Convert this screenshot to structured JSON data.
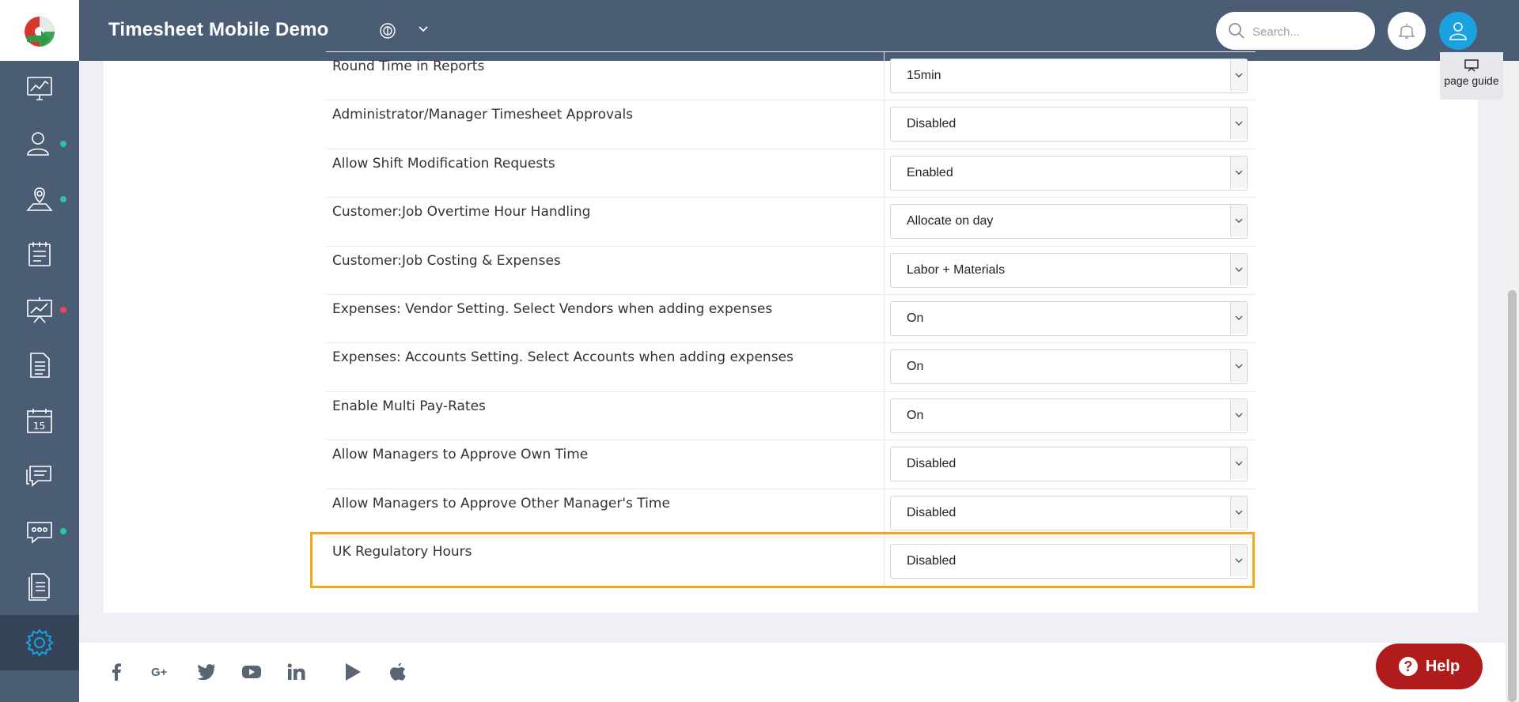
{
  "header": {
    "app_title": "Timesheet Mobile Demo",
    "search_placeholder": "Search..."
  },
  "page_guide_label": "page guide",
  "settings": [
    {
      "label": "Round Time in Reports",
      "value": "15min"
    },
    {
      "label": "Administrator/Manager Timesheet Approvals",
      "value": "Disabled"
    },
    {
      "label": "Allow Shift Modification Requests",
      "value": "Enabled"
    },
    {
      "label": "Customer:Job Overtime Hour Handling",
      "value": "Allocate on day"
    },
    {
      "label": "Customer:Job Costing & Expenses",
      "value": "Labor + Materials"
    },
    {
      "label": "Expenses: Vendor Setting. Select Vendors when adding expenses",
      "value": "On"
    },
    {
      "label": "Expenses: Accounts Setting. Select Accounts when adding expenses",
      "value": "On"
    },
    {
      "label": "Enable Multi Pay-Rates",
      "value": "On"
    },
    {
      "label": "Allow Managers to Approve Own Time",
      "value": "Disabled"
    },
    {
      "label": "Allow Managers to Approve Other Manager's Time",
      "value": "Disabled"
    },
    {
      "label": "UK Regulatory Hours",
      "value": "Disabled"
    }
  ],
  "help_label": "Help",
  "colors": {
    "sidebar": "#4a5d75",
    "sidebar_active": "#344559",
    "highlight": "#f5a71b",
    "help": "#b01c1c",
    "user_avatar": "#1aa1e0",
    "status_green": "#2ec4a0",
    "status_red": "#e8455a"
  },
  "sidebar_icons": [
    "dashboard-icon",
    "users-icon",
    "map-pin-icon",
    "clipboard-icon",
    "reports-chart-icon",
    "document-icon",
    "calendar-icon",
    "chat-icon",
    "messages-icon",
    "notes-icon",
    "settings-gear-icon"
  ],
  "footer_icons": [
    "facebook-icon",
    "google-plus-icon",
    "twitter-icon",
    "youtube-icon",
    "linkedin-icon",
    "google-play-icon",
    "apple-icon"
  ]
}
